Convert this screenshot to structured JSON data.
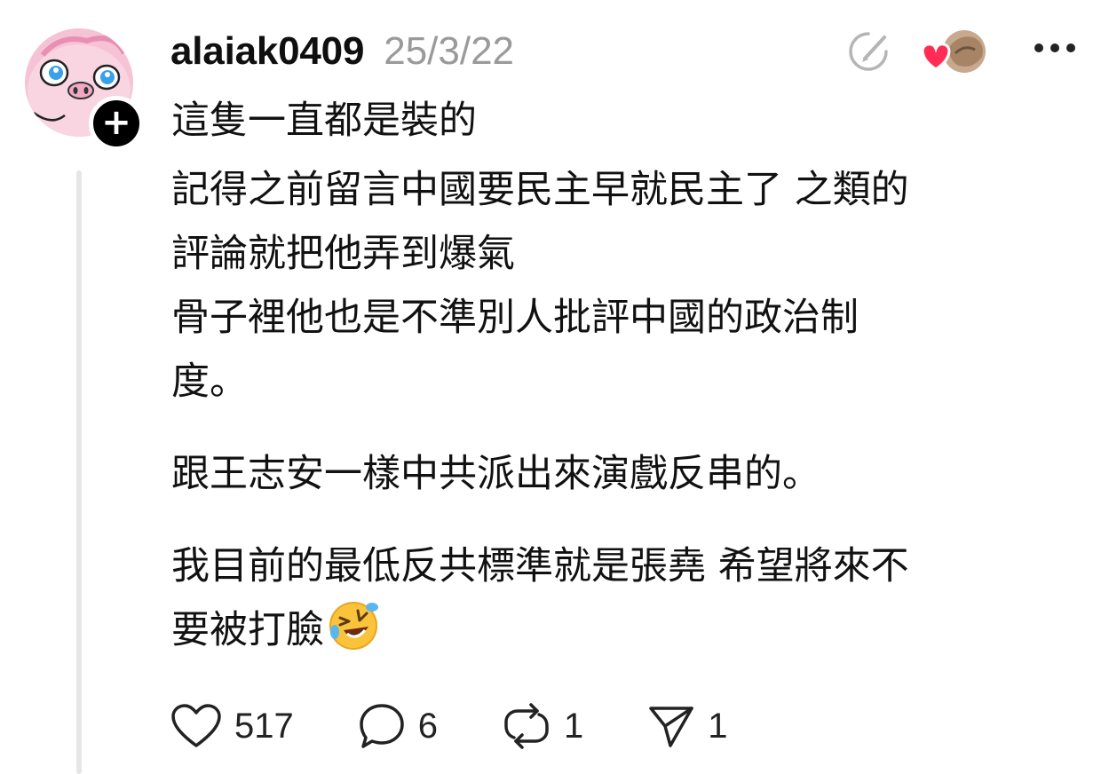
{
  "post": {
    "username": "alaiak0409",
    "timestamp": "25/3/22",
    "follow_badge": "+",
    "icons": {
      "edit": "pencil-circle-icon",
      "liked_by": "liked-by-avatar-heart-icon",
      "more": "more-dots-icon"
    },
    "lines": [
      "這隻一直都是裝的",
      "記得之前留言中國要民主早就民主了 之類的",
      "評論就把他弄到爆氣",
      "骨子裡他也是不準別人批評中國的政治制",
      "度。",
      "跟王志安一樣中共派出來演戲反串的。",
      "我目前的最低反共標準就是張堯 希望將來不",
      "要被打臉"
    ],
    "emoji": "rolling-on-floor-laughing-emoji"
  },
  "actions": {
    "likes": "517",
    "comments": "6",
    "reposts": "1",
    "shares": "1"
  },
  "colors": {
    "text": "#111111",
    "muted": "#9a9a9a",
    "heart": "#ff2d55",
    "thread_line": "#e6e6e6",
    "avatar_bg": "#f7c5d6"
  }
}
